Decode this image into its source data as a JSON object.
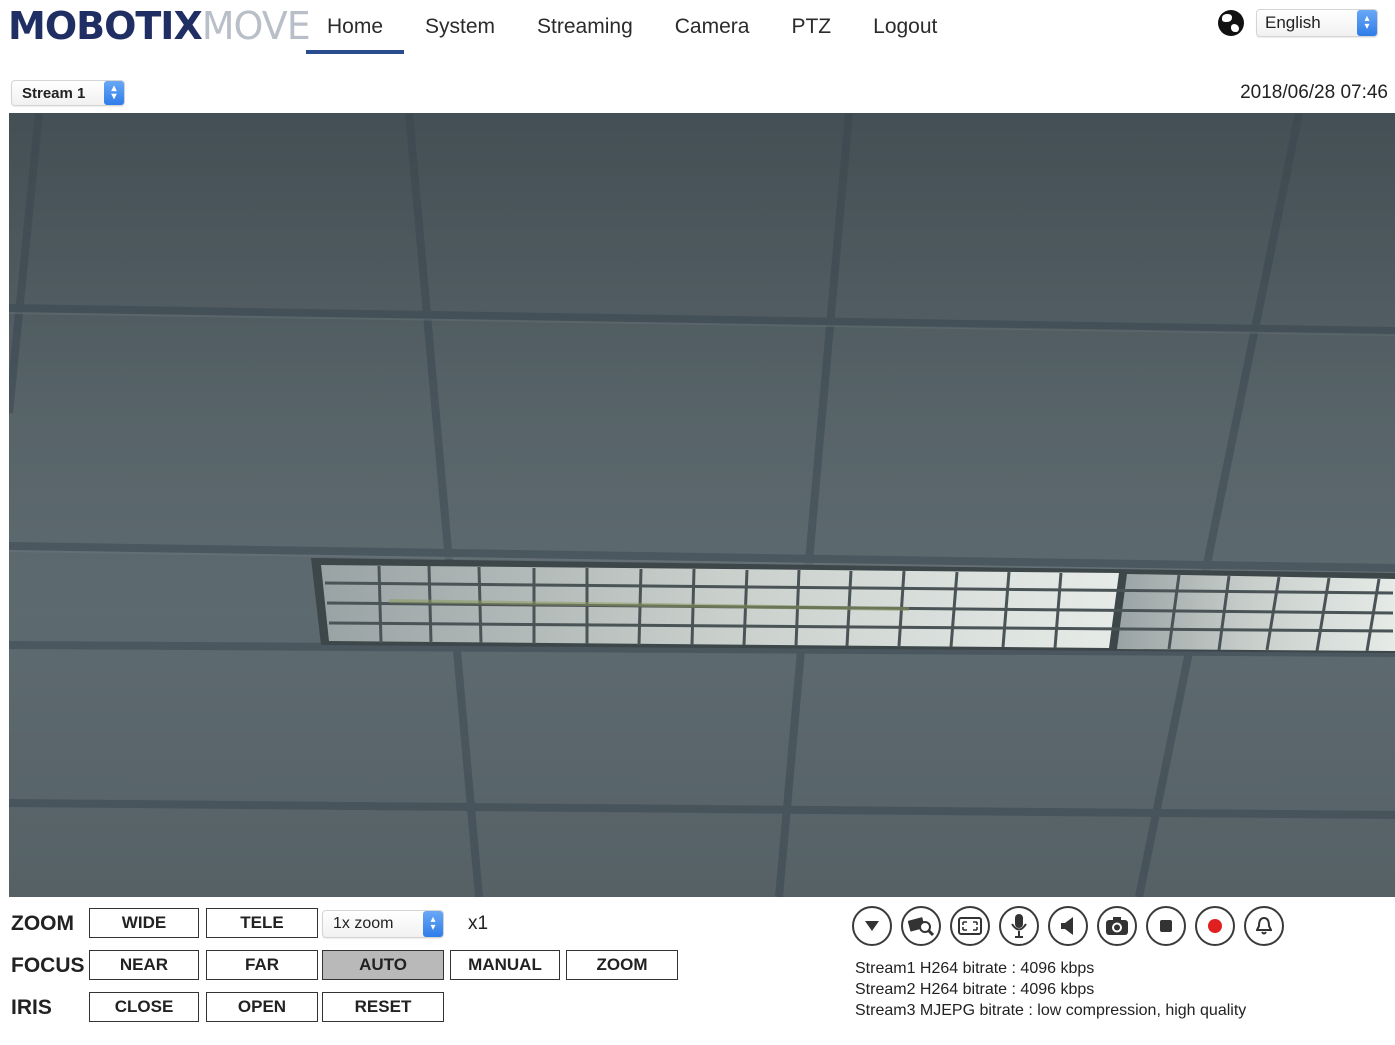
{
  "brand": {
    "part1": "MOBOTIX",
    "part2": "MOVE"
  },
  "nav": [
    {
      "label": "Home",
      "active": true
    },
    {
      "label": "System"
    },
    {
      "label": "Streaming"
    },
    {
      "label": "Camera"
    },
    {
      "label": "PTZ"
    },
    {
      "label": "Logout"
    }
  ],
  "language": {
    "selected": "English",
    "icon": "globe-icon"
  },
  "stream_select": {
    "selected": "Stream 1"
  },
  "datetime": "2018/06/28 07:46",
  "controls": {
    "zoom": {
      "label": "ZOOM",
      "wide": "WIDE",
      "tele": "TELE",
      "select": "1x zoom",
      "level": "x1"
    },
    "focus": {
      "label": "FOCUS",
      "near": "NEAR",
      "far": "FAR",
      "auto": "AUTO",
      "manual": "MANUAL",
      "zoom": "ZOOM",
      "active": "AUTO"
    },
    "iris": {
      "label": "IRIS",
      "close": "CLOSE",
      "open": "OPEN",
      "reset": "RESET"
    }
  },
  "toolbar_icons": [
    "dropdown-icon",
    "pip-zoom-icon",
    "fullscreen-icon",
    "microphone-icon",
    "speaker-icon",
    "snapshot-icon",
    "stop-icon",
    "record-icon",
    "alarm-icon"
  ],
  "stream_info": [
    "Stream1 H264 bitrate : 4096 kbps",
    "Stream2 H264 bitrate : 4096 kbps",
    "Stream3 MJEPG bitrate : low compression, high quality"
  ],
  "colors": {
    "nav_accent": "#2a4d8f",
    "select_accent": "#2f7de9",
    "record": "#e02020"
  }
}
